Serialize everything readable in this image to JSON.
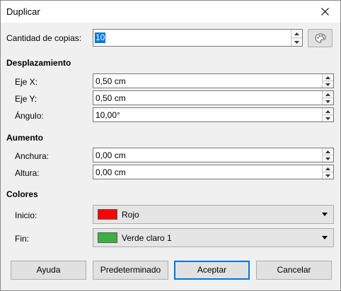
{
  "window": {
    "title": "Duplicar"
  },
  "copies": {
    "label": "Cantidad de copias:",
    "value": "10"
  },
  "displacement": {
    "heading": "Desplazamiento",
    "x_label": "Eje X:",
    "x_value": "0,50 cm",
    "y_label": "Eje Y:",
    "y_value": "0,50 cm",
    "angle_label": "Ángulo:",
    "angle_value": "10,00°"
  },
  "enlargement": {
    "heading": "Aumento",
    "width_label": "Anchura:",
    "width_value": "0,00 cm",
    "height_label": "Altura:",
    "height_value": "0,00 cm"
  },
  "colors": {
    "heading": "Colores",
    "start_label": "Inicio:",
    "start_value": "Rojo",
    "start_color": "#ff0000",
    "end_label": "Fin:",
    "end_value": "Verde claro 1",
    "end_color": "#3cb043"
  },
  "buttons": {
    "help": "Ayuda",
    "default": "Predeterminado",
    "ok": "Aceptar",
    "cancel": "Cancelar"
  },
  "icons": {
    "close": "close-icon",
    "palette": "palette-icon",
    "spin_up": "chevron-up-icon",
    "spin_down": "chevron-down-icon",
    "dropdown": "dropdown-arrow-icon"
  },
  "accent_color": "#0078d7"
}
